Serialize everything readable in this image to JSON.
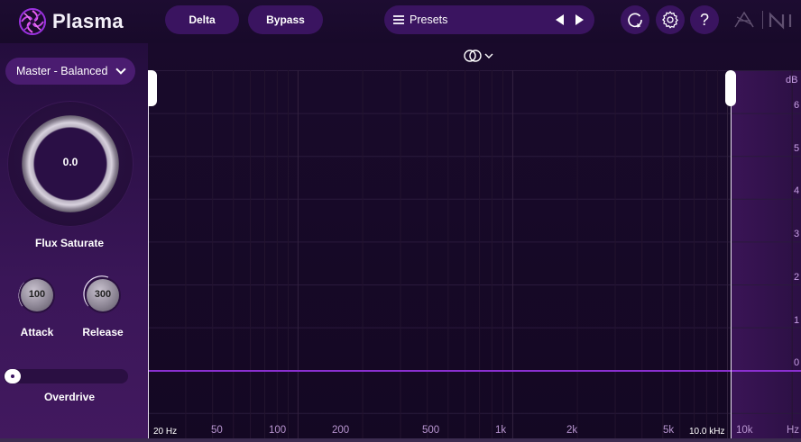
{
  "app": {
    "name": "Plasma"
  },
  "toolbar": {
    "delta_label": "Delta",
    "bypass_label": "Bypass",
    "presets_label": "Presets",
    "help_label": "?"
  },
  "sidebar": {
    "mode": "Master - Balanced",
    "flux_saturate": {
      "value": "0.0",
      "label": "Flux Saturate"
    },
    "attack": {
      "value": "100",
      "label": "Attack"
    },
    "release": {
      "value": "300",
      "label": "Release"
    },
    "overdrive": {
      "label": "Overdrive",
      "value": 0
    }
  },
  "display": {
    "db_unit": "dB",
    "db_ticks": [
      "6",
      "5",
      "4",
      "3",
      "2",
      "1",
      "0"
    ],
    "left_freq": "20 Hz",
    "right_freq": "10.0 kHz",
    "freq_ticks": [
      "50",
      "100",
      "200",
      "500",
      "1k",
      "2k",
      "5k",
      "10k"
    ],
    "hz_unit": "Hz"
  },
  "colors": {
    "accent": "#8a2fd0",
    "panel": "#3a1460",
    "background": "#140823"
  }
}
